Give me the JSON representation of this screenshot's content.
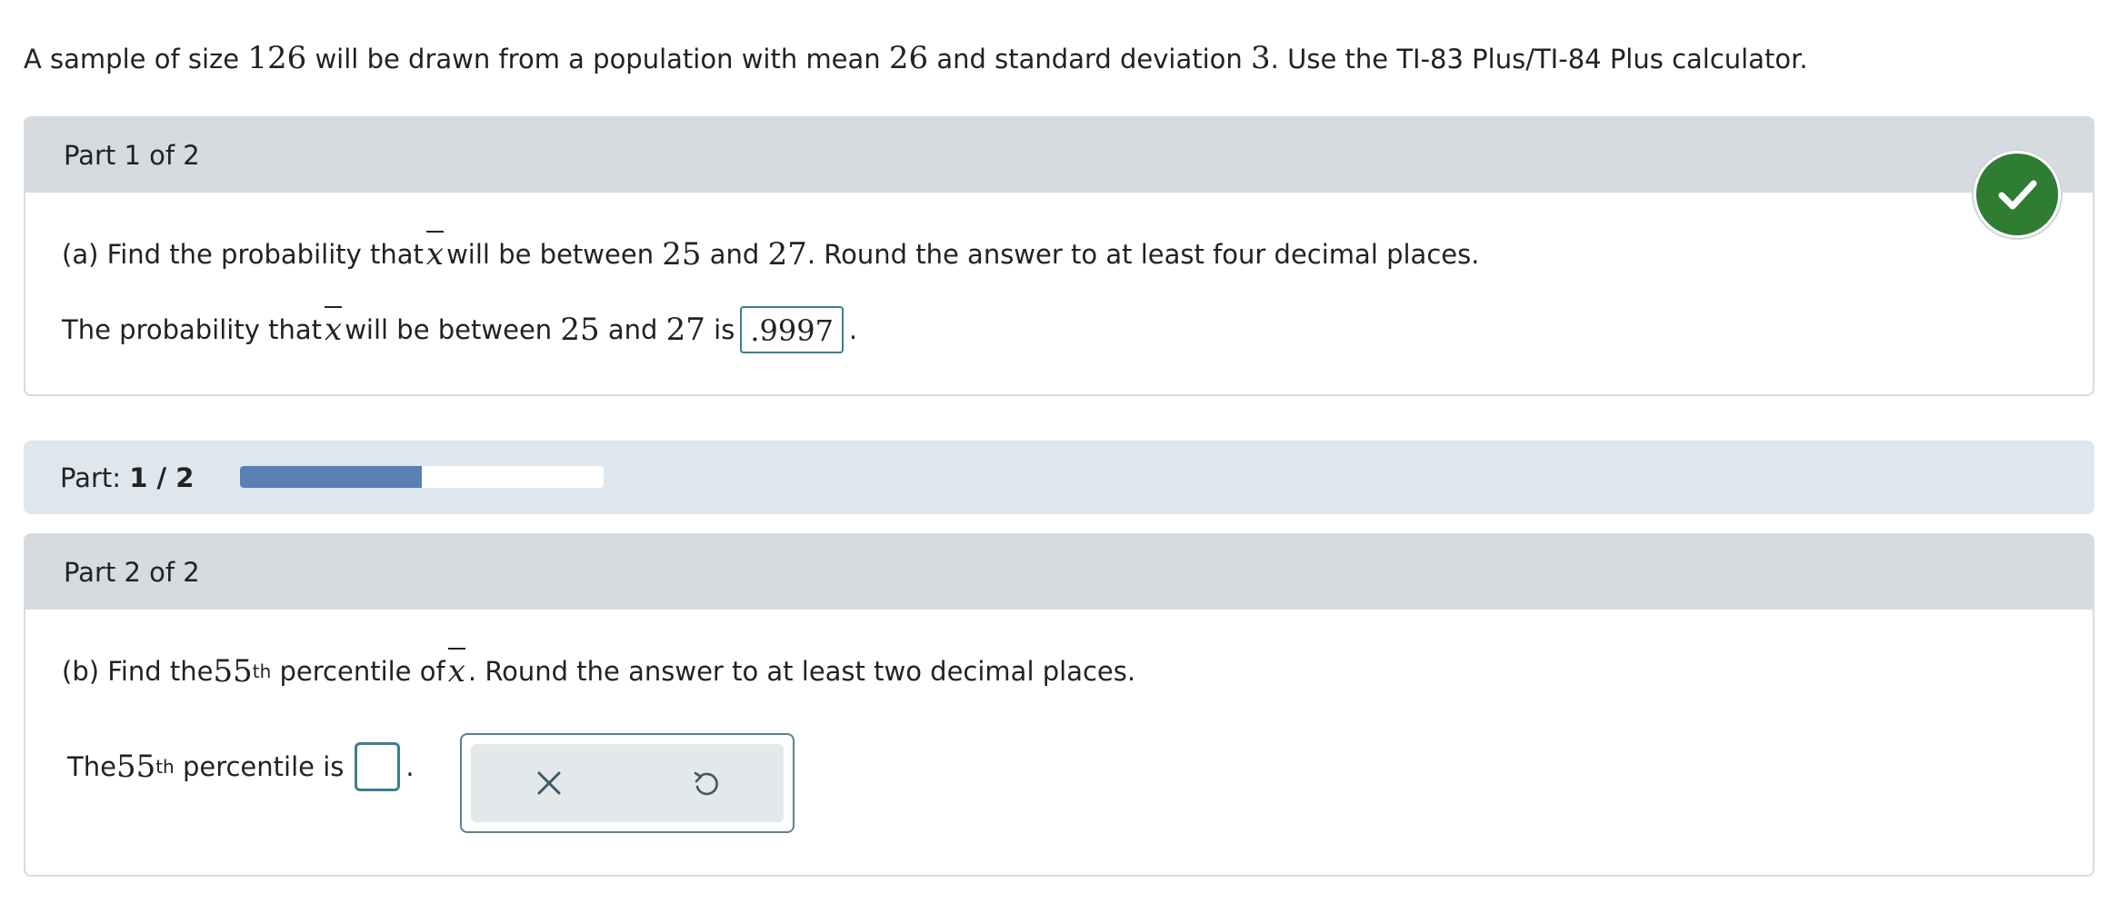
{
  "intro": {
    "t1": "A sample of size ",
    "n": "126",
    "t2": " will be drawn from a population with mean ",
    "mean": "26",
    "t3": " and standard deviation ",
    "sd": "3",
    "t4": ". Use the TI-83 Plus/TI-84 Plus calculator."
  },
  "part1": {
    "header": "Part 1 of 2",
    "question": {
      "t1": "(a) Find the probability that ",
      "xbar": "x",
      "t2": " will be between ",
      "a": "25",
      "t3": " and ",
      "b": "27",
      "t4": ". Round the answer to at least four decimal places."
    },
    "answer_line": {
      "t1": "The probability that ",
      "xbar": "x",
      "t2": " will be between ",
      "a": "25",
      "t3": " and ",
      "b": "27",
      "t4": " is",
      "value": ".9997",
      "t5": "."
    },
    "status_icon": "check-circle-icon"
  },
  "progress": {
    "label": "Part: ",
    "current": "1 / 2",
    "fraction": 0.5,
    "fill_color": "#5b80b4"
  },
  "part2": {
    "header": "Part 2 of 2",
    "question": {
      "t1": "(b) Find the ",
      "pct": "55",
      "sup": "th",
      "t2": " percentile of ",
      "xbar": "x",
      "t3": ". Round the answer to at least two decimal places."
    },
    "answer_line": {
      "t1": "The ",
      "pct": "55",
      "sup": "th",
      "t2": " percentile is",
      "value": "",
      "t3": "."
    },
    "tools": {
      "clear_icon": "x-icon",
      "undo_icon": "undo-icon"
    }
  },
  "colors": {
    "header_bg": "#d5dbdf",
    "progress_bg": "#dfe7ee",
    "check_green": "#2e7d32",
    "input_border": "#3f7e8f"
  }
}
